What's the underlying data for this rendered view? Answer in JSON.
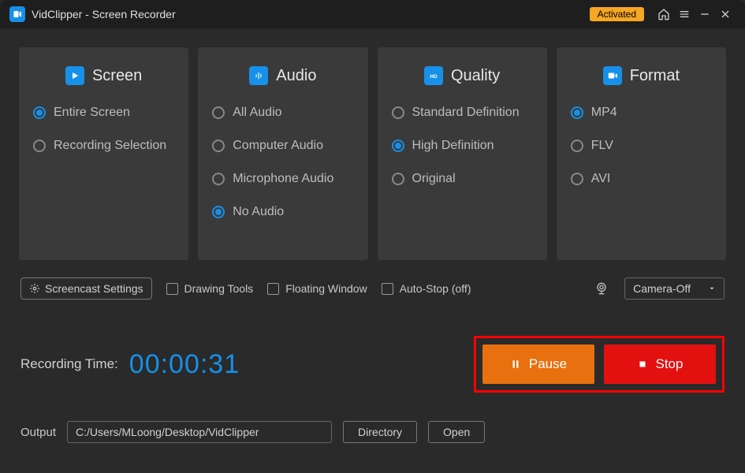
{
  "titlebar": {
    "app_title": "VidClipper - Screen Recorder",
    "activated_label": "Activated"
  },
  "cards": {
    "screen": {
      "title": "Screen",
      "options": [
        "Entire Screen",
        "Recording Selection"
      ],
      "selected": "Entire Screen"
    },
    "audio": {
      "title": "Audio",
      "options": [
        "All Audio",
        "Computer Audio",
        "Microphone Audio",
        "No Audio"
      ],
      "selected": "No Audio"
    },
    "quality": {
      "title": "Quality",
      "options": [
        "Standard Definition",
        "High Definition",
        "Original"
      ],
      "selected": "High Definition"
    },
    "format": {
      "title": "Format",
      "options": [
        "MP4",
        "FLV",
        "AVI"
      ],
      "selected": "MP4"
    }
  },
  "toolbar": {
    "screencast_settings": "Screencast Settings",
    "drawing_tools": "Drawing Tools",
    "floating_window": "Floating Window",
    "auto_stop": "Auto-Stop  (off)",
    "camera_dropdown": "Camera-Off"
  },
  "recording": {
    "label": "Recording Time:",
    "time": "00:00:31",
    "pause_label": "Pause",
    "stop_label": "Stop"
  },
  "output": {
    "label": "Output",
    "path": "C:/Users/MLoong/Desktop/VidClipper",
    "directory_label": "Directory",
    "open_label": "Open"
  },
  "colors": {
    "accent": "#1690e8",
    "pause": "#e8700f",
    "stop": "#e31010",
    "activated": "#f5a623"
  }
}
